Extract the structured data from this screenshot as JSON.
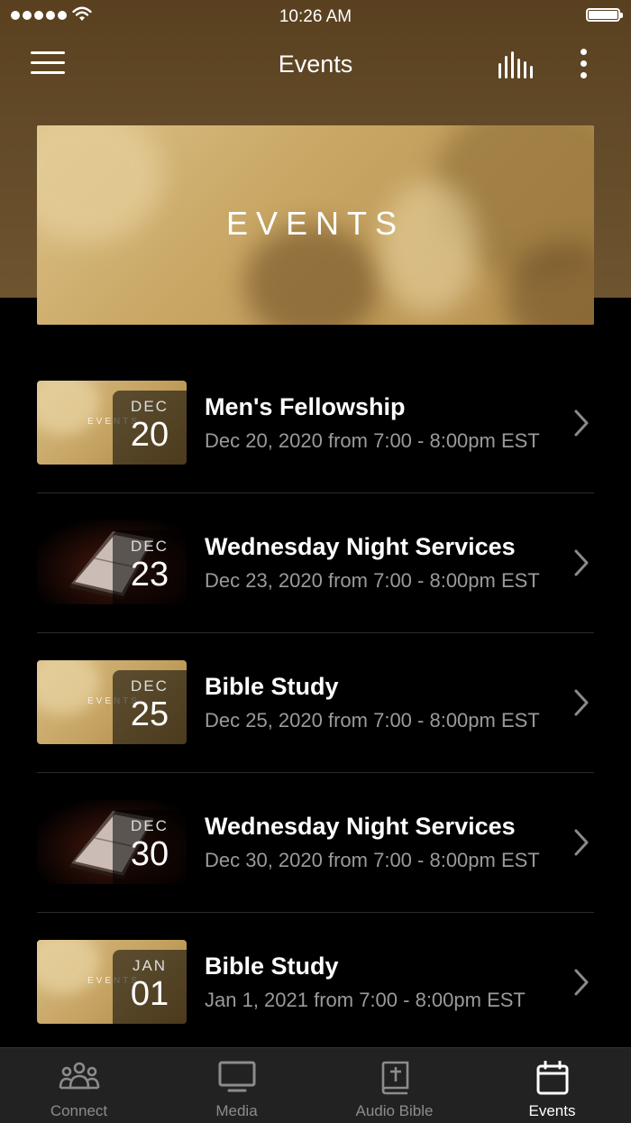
{
  "status_bar": {
    "time": "10:26 AM"
  },
  "nav": {
    "title": "Events"
  },
  "banner": {
    "text": "EVENTS"
  },
  "events": [
    {
      "title": "Men's Fellowship",
      "subtitle": "Dec 20, 2020 from 7:00 - 8:00pm EST",
      "month": "DEC",
      "day": "20",
      "thumb": "gold",
      "thumb_word": "EVENTS"
    },
    {
      "title": "Wednesday Night Services",
      "subtitle": "Dec 23, 2020 from 7:00 - 8:00pm EST",
      "month": "DEC",
      "day": "23",
      "thumb": "bible"
    },
    {
      "title": "Bible Study",
      "subtitle": "Dec 25, 2020 from 7:00 - 8:00pm EST",
      "month": "DEC",
      "day": "25",
      "thumb": "gold",
      "thumb_word": "EVENTS"
    },
    {
      "title": "Wednesday Night Services",
      "subtitle": "Dec 30, 2020 from 7:00 - 8:00pm EST",
      "month": "DEC",
      "day": "30",
      "thumb": "bible"
    },
    {
      "title": "Bible Study",
      "subtitle": "Jan 1, 2021 from 7:00 - 8:00pm EST",
      "month": "JAN",
      "day": "01",
      "thumb": "gold",
      "thumb_word": "EVENTS"
    }
  ],
  "tabs": [
    {
      "label": "Connect",
      "icon": "people-icon",
      "active": false
    },
    {
      "label": "Media",
      "icon": "monitor-icon",
      "active": false
    },
    {
      "label": "Audio Bible",
      "icon": "bible-icon",
      "active": false
    },
    {
      "label": "Events",
      "icon": "calendar-icon",
      "active": true
    }
  ],
  "colors": {
    "header_brown": "#634a28",
    "banner_gold": "#c9a765",
    "tab_bar": "#222222",
    "inactive_tab": "#8c8c8c"
  }
}
